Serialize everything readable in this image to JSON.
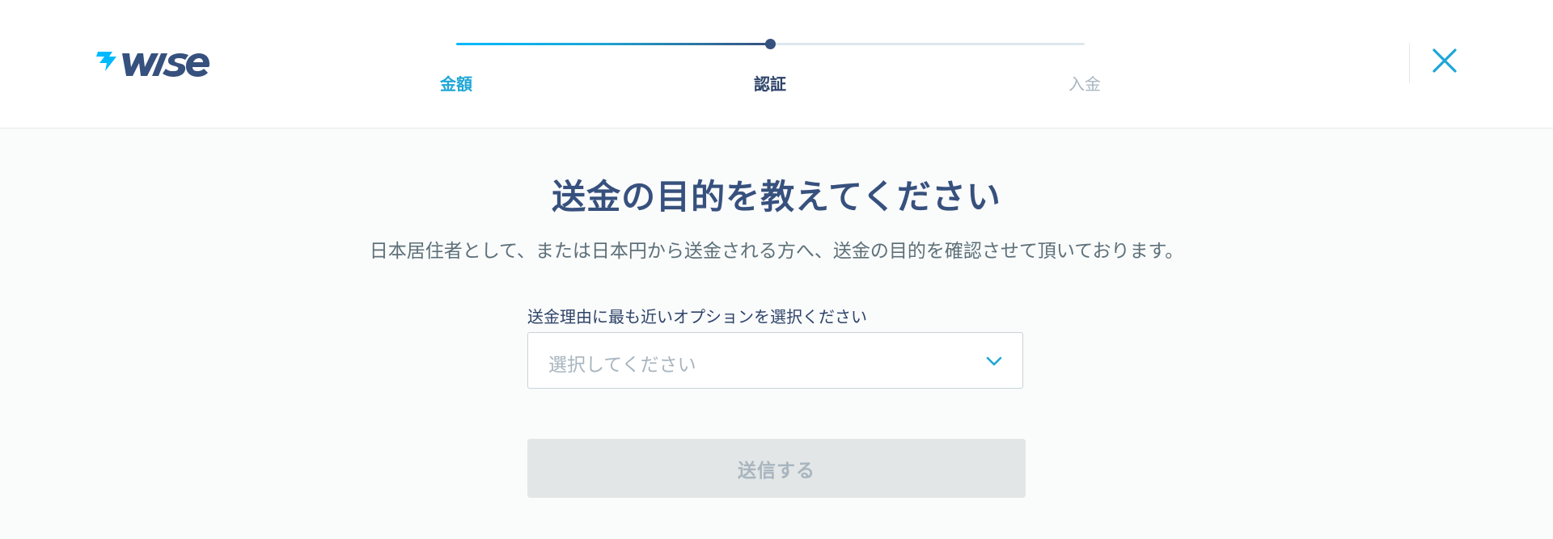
{
  "brand": {
    "name": "wise",
    "accent_color": "#00b9ff",
    "text_color": "#37517e"
  },
  "stepper": {
    "progress_fraction": 0.5,
    "steps": [
      {
        "label": "金額",
        "state": "done"
      },
      {
        "label": "認証",
        "state": "current"
      },
      {
        "label": "入金",
        "state": "upcoming"
      }
    ]
  },
  "header": {
    "close_icon": "close-icon"
  },
  "main": {
    "title": "送金の目的を教えてください",
    "subtitle": "日本居住者として、または日本円から送金される方へ、送金の目的を確認させて頂いております。",
    "field_label": "送金理由に最も近いオプションを選択ください",
    "select_placeholder": "選択してください",
    "select_icon": "chevron-down-icon",
    "submit_label": "送信する",
    "submit_disabled": true
  }
}
